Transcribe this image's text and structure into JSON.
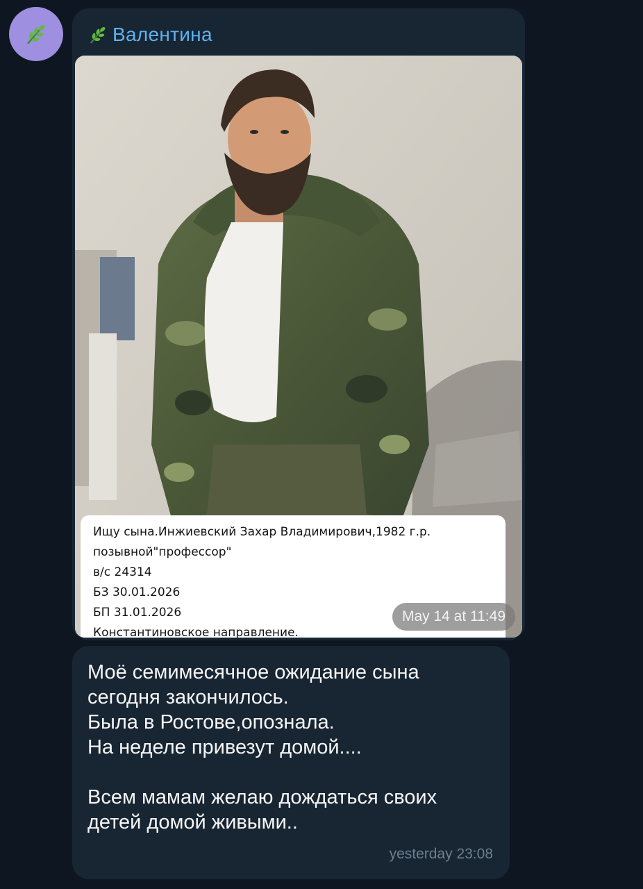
{
  "chat": {
    "sender_name": "Валентина",
    "avatar_icon": "leaf-icon",
    "sender_icon": "herb-leaf-icon",
    "accent_color": "#5eb2ef",
    "avatar_color": "#9f8fe0"
  },
  "photo_message": {
    "caption_lines": [
      "Ищу сына.Инжиевский Захар Владимирович,1982 г.р.",
      "позывной\"профессор\"",
      "в/с 24314",
      "БЗ 30.01.2026",
      "БП 31.01.2026",
      "Константиновское направление."
    ],
    "timestamp": "May 14 at 11:49"
  },
  "text_message": {
    "lines": [
      "Моё семимесячное ожидание сына",
      "сегодня закончилось.",
      "Была в Ростове,опознала.",
      "На неделе привезут домой....",
      "",
      "Всем мамам желаю дождаться своих",
      "детей домой живыми.."
    ],
    "timestamp": "yesterday 23:08"
  }
}
